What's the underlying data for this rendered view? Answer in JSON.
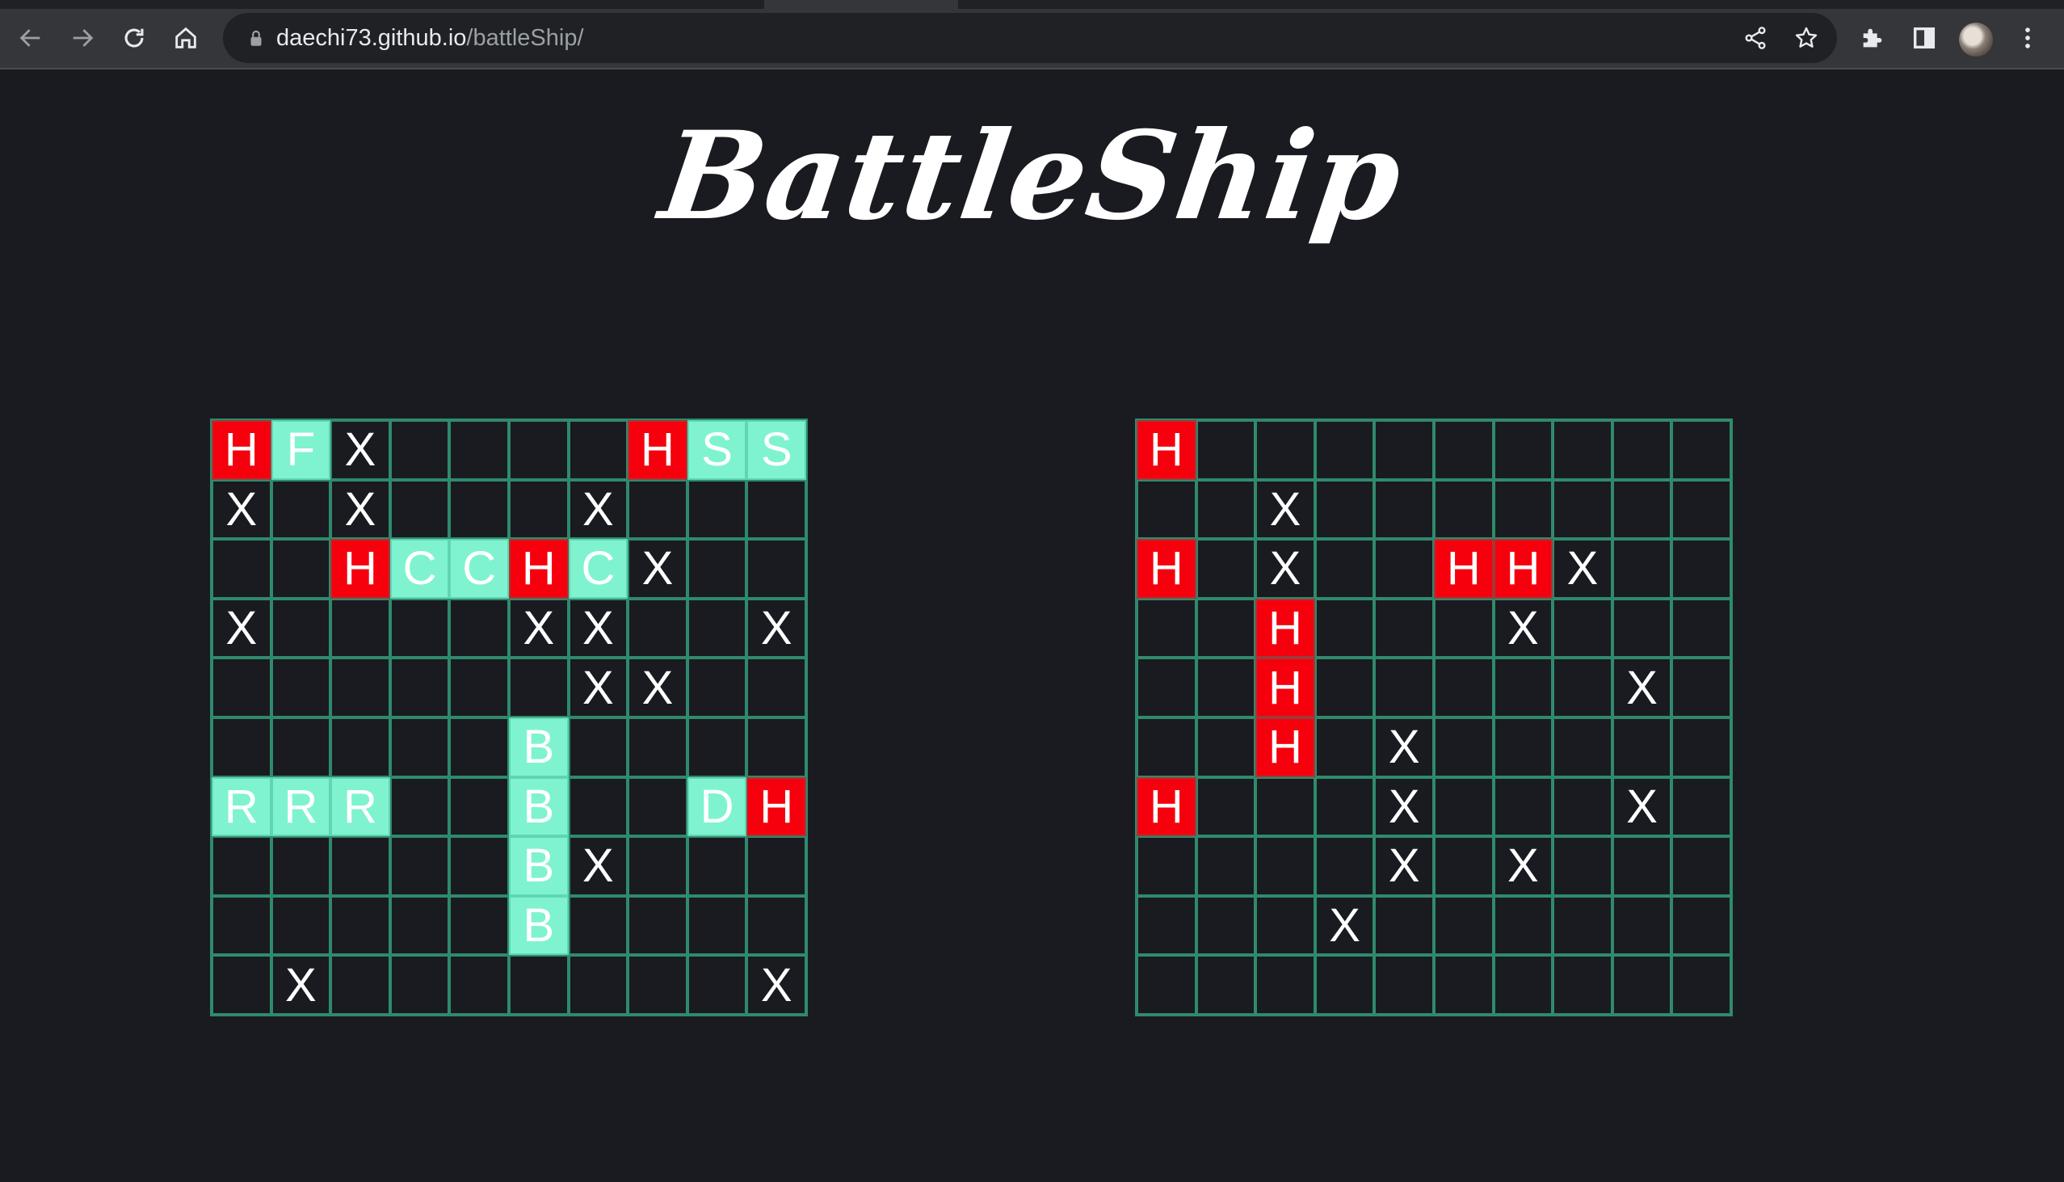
{
  "browser": {
    "url_host": "daechi73.github.io",
    "url_path": "/battleShip/"
  },
  "page": {
    "title": "BattleShip"
  },
  "legend_note": "",
  "player_board": [
    [
      "H",
      "F",
      "X",
      "",
      "",
      "",
      "",
      "H",
      "S",
      "S"
    ],
    [
      "X",
      "",
      "X",
      "",
      "",
      "",
      "X",
      "",
      "",
      ""
    ],
    [
      "",
      "",
      "H",
      "C",
      "C",
      "H",
      "C",
      "X",
      "",
      ""
    ],
    [
      "X",
      "",
      "",
      "",
      "",
      "X",
      "X",
      "",
      "",
      "X"
    ],
    [
      "",
      "",
      "",
      "",
      "",
      "",
      "X",
      "X",
      "",
      ""
    ],
    [
      "",
      "",
      "",
      "",
      "",
      "B",
      "",
      "",
      "",
      ""
    ],
    [
      "R",
      "R",
      "R",
      "",
      "",
      "B",
      "",
      "",
      "D",
      "H"
    ],
    [
      "",
      "",
      "",
      "",
      "",
      "B",
      "X",
      "",
      "",
      ""
    ],
    [
      "",
      "",
      "",
      "",
      "",
      "B",
      "",
      "",
      "",
      ""
    ],
    [
      "",
      "X",
      "",
      "",
      "",
      "",
      "",
      "",
      "",
      "X"
    ]
  ],
  "enemy_board": [
    [
      "H",
      "",
      "",
      "",
      "",
      "",
      "",
      "",
      "",
      ""
    ],
    [
      "",
      "",
      "X",
      "",
      "",
      "",
      "",
      "",
      "",
      ""
    ],
    [
      "H",
      "",
      "X",
      "",
      "",
      "H",
      "H",
      "X",
      "",
      ""
    ],
    [
      "",
      "",
      "H",
      "",
      "",
      "",
      "X",
      "",
      "",
      ""
    ],
    [
      "",
      "",
      "H",
      "",
      "",
      "",
      "",
      "",
      "X",
      ""
    ],
    [
      "",
      "",
      "H",
      "",
      "X",
      "",
      "",
      "",
      "",
      ""
    ],
    [
      "H",
      "",
      "",
      "",
      "X",
      "",
      "",
      "",
      "X",
      ""
    ],
    [
      "",
      "",
      "",
      "",
      "X",
      "",
      "X",
      "",
      "",
      ""
    ],
    [
      "",
      "",
      "",
      "X",
      "",
      "",
      "",
      "",
      "",
      ""
    ],
    [
      "",
      "",
      "",
      "",
      "",
      "",
      "",
      "",
      "",
      ""
    ]
  ],
  "colors": {
    "hit": "#f5000c",
    "ship": "#7ff3cf",
    "grid": "#2f8a6c",
    "background": "#191b20"
  },
  "icons": {
    "back": "back-arrow-icon",
    "forward": "forward-arrow-icon",
    "reload": "reload-icon",
    "home": "home-icon",
    "lock": "lock-icon",
    "share": "share-icon",
    "bookmark": "star-icon",
    "extensions": "puzzle-icon",
    "side_panel": "side-panel-icon",
    "menu": "kebab-menu-icon"
  }
}
